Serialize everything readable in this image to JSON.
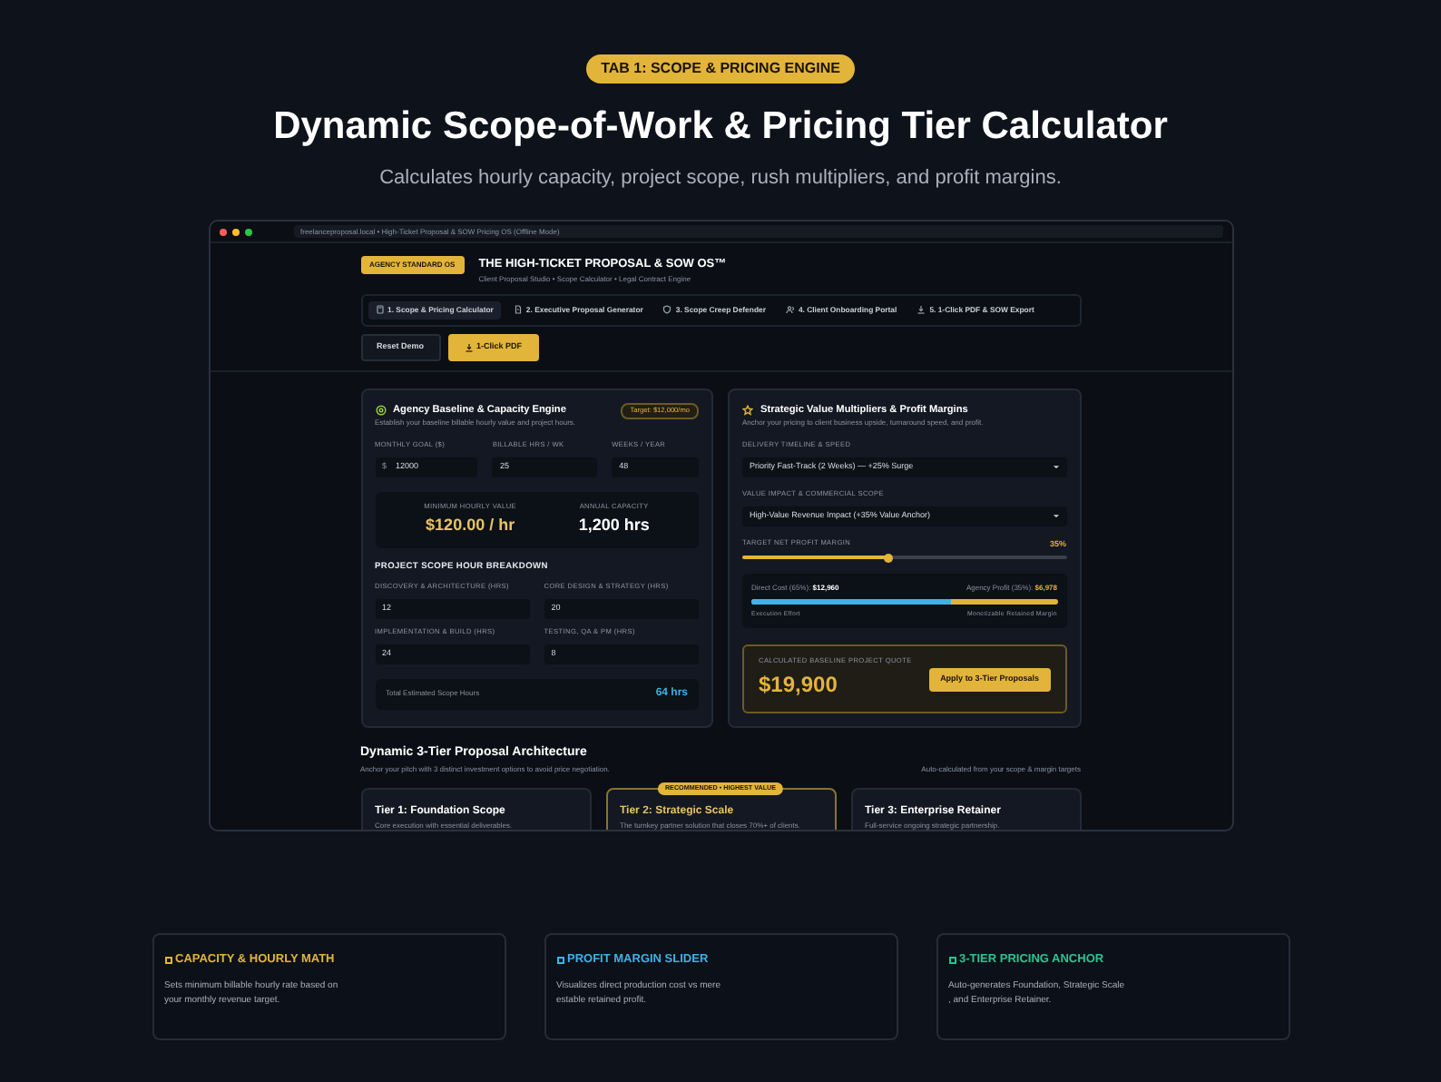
{
  "page_badge": "TAB 1: SCOPE & PRICING ENGINE",
  "page_title": "Dynamic Scope-of-Work & Pricing Tier Calculator",
  "page_subtitle": "Calculates hourly capacity, project scope, rush multipliers, and profit margins.",
  "app_window": {
    "address": "freelanceproposal.local • High-Ticket Proposal & SOW Pricing OS (Offline Mode)"
  },
  "app_header": {
    "badge": "AGENCY STANDARD OS",
    "title": "THE HIGH-TICKET PROPOSAL & SOW OS™",
    "subtitle": "Client Proposal Studio • Scope Calculator • Legal Contract Engine"
  },
  "nav_tabs": [
    {
      "label": "1. Scope & Pricing Calculator",
      "kind": "calculator",
      "selected": true
    },
    {
      "label": "2. Executive Proposal Generator",
      "kind": "document",
      "selected": false
    },
    {
      "label": "3. Scope Creep Defender",
      "kind": "shield",
      "selected": false
    },
    {
      "label": "4. Client Onboarding Portal",
      "kind": "people",
      "selected": false
    },
    {
      "label": "5. 1-Click PDF & SOW Export",
      "kind": "download",
      "selected": false
    }
  ],
  "actions": [
    {
      "label": "Reset Demo",
      "kind": "secondary"
    },
    {
      "label": "1-Click PDF",
      "kind": "primary"
    }
  ],
  "baseline_panel": {
    "title": "Agency Baseline & Capacity Engine",
    "subtitle": "Establish your baseline billable hourly value and project hours.",
    "badge": "Target: $12,000/mo",
    "fields": [
      {
        "label": "MONTHLY GOAL ($)",
        "prefix": "$",
        "value": "12000"
      },
      {
        "label": "BILLABLE HRS / WK",
        "value": "25"
      },
      {
        "label": "WEEKS / YEAR",
        "value": "48"
      }
    ],
    "metrics": [
      {
        "label": "MINIMUM HOURLY VALUE",
        "value": "$120.00 / hr",
        "kind": "accent"
      },
      {
        "label": "ANNUAL CAPACITY",
        "value": "1,200 hrs",
        "kind": "plain"
      }
    ],
    "breakdown_title": "PROJECT SCOPE HOUR BREAKDOWN",
    "scope_fields": [
      {
        "label": "DISCOVERY & ARCHITECTURE (HRS)",
        "value": "12"
      },
      {
        "label": "CORE DESIGN & STRATEGY (HRS)",
        "value": "20"
      },
      {
        "label": "IMPLEMENTATION & BUILD (HRS)",
        "value": "24"
      },
      {
        "label": "TESTING, QA & PM (HRS)",
        "value": "8"
      }
    ],
    "total": {
      "label": "Total Estimated Scope Hours",
      "value": "64 hrs"
    }
  },
  "value_panel": {
    "title": "Strategic Value Multipliers & Profit Margins",
    "subtitle": "Anchor your pricing to client business upside, turnaround speed, and profit.",
    "selects": [
      {
        "label": "DELIVERY TIMELINE & SPEED",
        "value": "Priority Fast-Track (2 Weeks) — +25% Surge"
      },
      {
        "label": "VALUE IMPACT & COMMERCIAL SCOPE",
        "value": "High-Value Revenue Impact (+35% Value Anchor)"
      }
    ],
    "margin": {
      "label": "TARGET NET PROFIT MARGIN",
      "reading": "35%",
      "level": 0.45
    },
    "split": {
      "cost_label": "Direct Cost (65%):",
      "cost_value": "$12,960",
      "profit_label": "Agency Profit (35%):",
      "profit_value": "$6,978",
      "level": 0.65,
      "left_caption": "Execution Effort",
      "right_caption": "Monetizable Retained Margin"
    },
    "quote": {
      "label": "CALCULATED BASELINE PROJECT QUOTE",
      "value": "$19,900",
      "button": "Apply to 3-Tier Proposals"
    }
  },
  "tiers_section": {
    "title": "Dynamic 3-Tier Proposal Architecture",
    "subtitle": "Anchor your pitch with 3 distinct investment options to avoid price negotiation.",
    "note": "Auto-calculated from your scope & margin targets",
    "tiers": [
      {
        "name": "Tier 1: Foundation Scope",
        "description": "Core execution with essential deliverables.",
        "selected": false
      },
      {
        "name": "Tier 2: Strategic Scale",
        "description": "The turnkey partner solution that closes 70%+ of clients.",
        "selected": true,
        "badge": "RECOMMENDED • HIGHEST VALUE"
      },
      {
        "name": "Tier 3: Enterprise Retainer",
        "description": "Full-service ongoing strategic partnership.",
        "selected": false
      }
    ]
  },
  "features": [
    {
      "title": "CAPACITY & HOURLY MATH",
      "text": "Sets minimum billable hourly rate based on\nyour monthly revenue target.",
      "color": "#e0b43c"
    },
    {
      "title": "PROFIT MARGIN SLIDER",
      "text": "Visualizes direct production cost vs mere\nestable retained profit.",
      "color": "#3fb2e6"
    },
    {
      "title": "3-TIER PRICING ANCHOR",
      "text": "Auto-generates Foundation, Strategic Scale\n, and Enterprise Retainer.",
      "color": "#2cc392"
    }
  ]
}
